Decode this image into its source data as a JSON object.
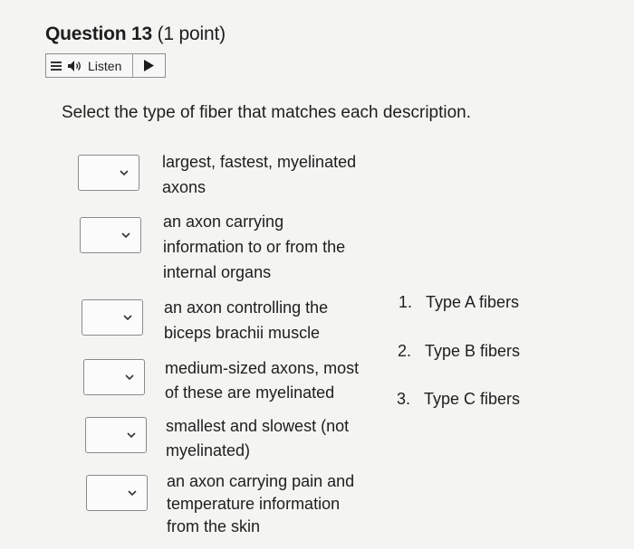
{
  "question": {
    "title": "Question 13",
    "points": "(1 point)"
  },
  "listen": {
    "label": "Listen"
  },
  "instruction": "Select the type of fiber that matches each description.",
  "items": [
    {
      "description": "largest, fastest, myelinated\naxons"
    },
    {
      "description": "an axon carrying\ninformation to or from the\ninternal organs"
    },
    {
      "description": "an axon controlling the\nbiceps brachii muscle"
    },
    {
      "description": "medium-sized axons, most\nof these are myelinated"
    },
    {
      "description": "smallest and slowest (not\nmyelinated)"
    },
    {
      "description": "an axon carrying pain and\ntemperature information\nfrom the skin"
    }
  ],
  "options": [
    {
      "number": "1.",
      "label": "Type A fibers"
    },
    {
      "number": "2.",
      "label": "Type B fibers"
    },
    {
      "number": "3.",
      "label": "Type C fibers"
    }
  ]
}
